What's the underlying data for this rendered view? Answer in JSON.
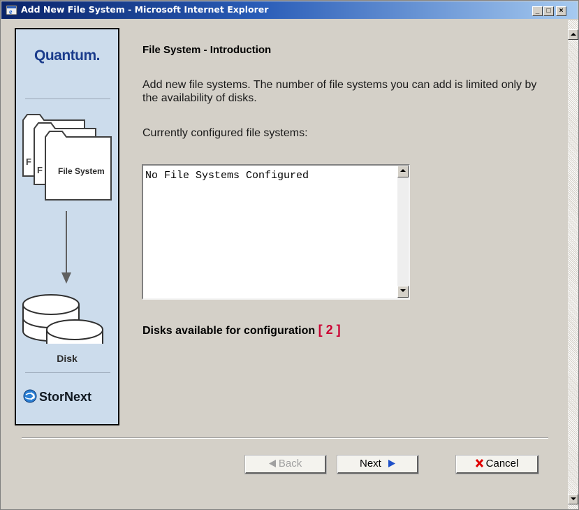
{
  "window": {
    "title": "Add New File System - Microsoft Internet Explorer",
    "controls": [
      "_",
      "□",
      "×"
    ]
  },
  "sidebar": {
    "brand": "Quantum.",
    "folder_label": "File System",
    "disk_label": "Disk",
    "product": "StorNext"
  },
  "main": {
    "heading": "File System - Introduction",
    "description": "Add new file systems. The number of file systems you can add is limited only by the availability of disks.",
    "configured_label": "Currently configured file systems:",
    "configured_list": "No File Systems Configured",
    "disks_label": "Disks available for configuration",
    "disks_count": "[ 2 ]"
  },
  "buttons": {
    "back": "Back",
    "next": "Next",
    "cancel": "Cancel"
  },
  "colors": {
    "title_bar": "#0a246a",
    "sidebar_bg": "#ccdcec",
    "disk_count": "#cc0033",
    "next_arrow": "#1e50c8",
    "cancel_x": "#e00000"
  }
}
